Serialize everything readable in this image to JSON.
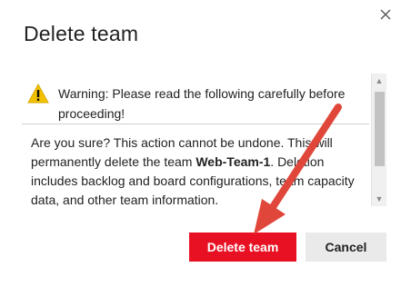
{
  "dialog": {
    "title": "Delete team",
    "close_icon": "close-icon"
  },
  "warning": {
    "icon": "warning-icon",
    "icon_color": "#f2c200",
    "text": "Warning: Please read the following carefully before proceeding!"
  },
  "body": {
    "text_before": "Are you sure? This action cannot be undone. This will permanently delete the team ",
    "team_name": "Web-Team-1",
    "text_after": ". Deletion includes backlog and board configurations, team capacity data, and other team information."
  },
  "buttons": {
    "delete_label": "Delete team",
    "cancel_label": "Cancel",
    "delete_color": "#e81123"
  },
  "annotation": {
    "arrow_color": "#e0473a"
  }
}
